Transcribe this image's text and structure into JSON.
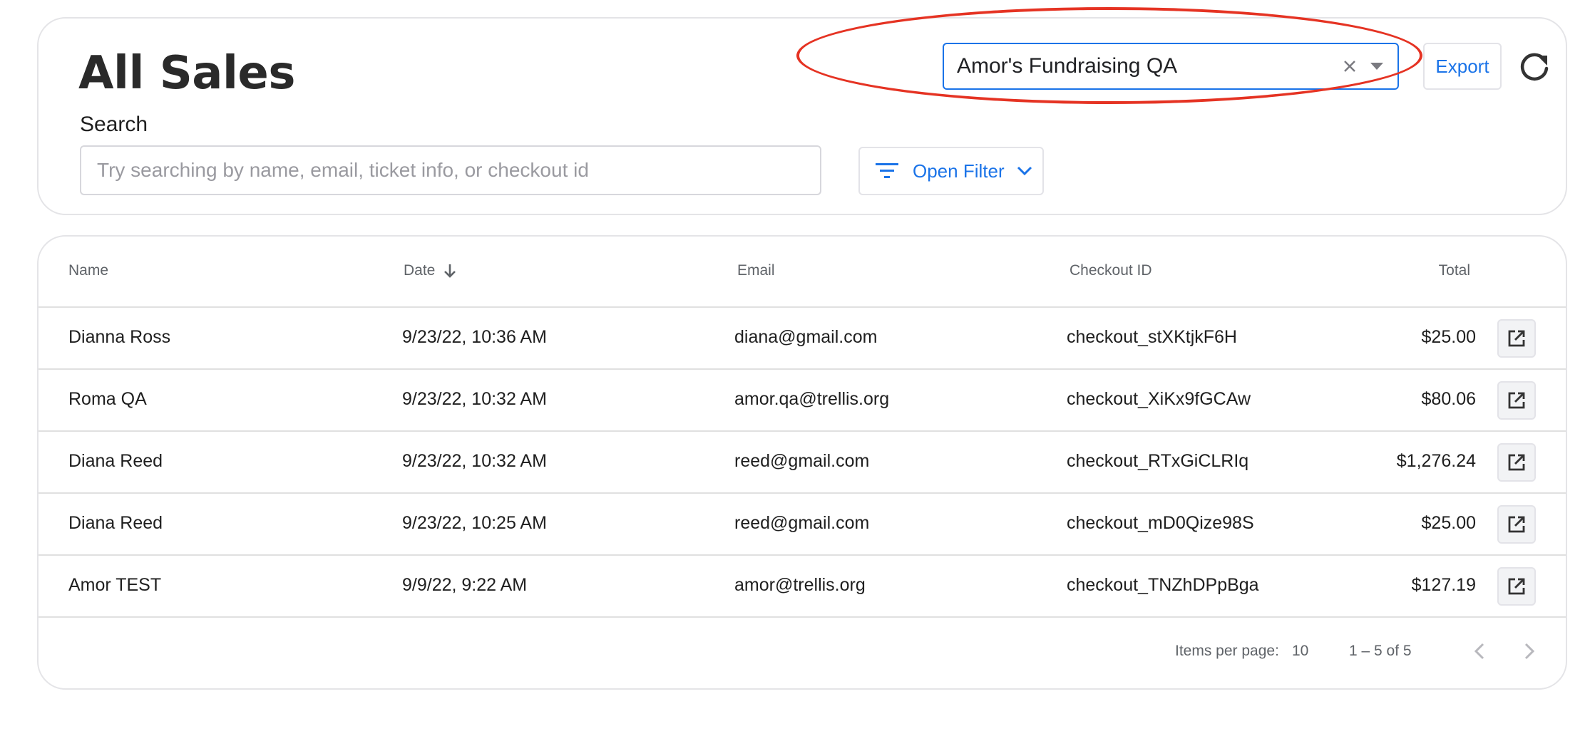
{
  "header": {
    "title": "All Sales",
    "search_label": "Search",
    "search_placeholder": "Try searching by name, email, ticket info, or checkout id",
    "search_value": "",
    "filter_label": "Open Filter",
    "org_select_value": "Amor's Fundraising QA",
    "export_label": "Export"
  },
  "table": {
    "columns": {
      "name": "Name",
      "date": "Date",
      "email": "Email",
      "checkout_id": "Checkout ID",
      "total": "Total"
    },
    "rows": [
      {
        "name": "Dianna Ross",
        "date": "9/23/22, 10:36 AM",
        "email": "diana@gmail.com",
        "checkout_id": "checkout_stXKtjkF6H",
        "total": "$25.00"
      },
      {
        "name": "Roma QA",
        "date": "9/23/22, 10:32 AM",
        "email": "amor.qa@trellis.org",
        "checkout_id": "checkout_XiKx9fGCAw",
        "total": "$80.06"
      },
      {
        "name": "Diana Reed",
        "date": "9/23/22, 10:32 AM",
        "email": "reed@gmail.com",
        "checkout_id": "checkout_RTxGiCLRIq",
        "total": "$1,276.24"
      },
      {
        "name": "Diana Reed",
        "date": "9/23/22, 10:25 AM",
        "email": "reed@gmail.com",
        "checkout_id": "checkout_mD0Qize98S",
        "total": "$25.00"
      },
      {
        "name": "Amor TEST",
        "date": "9/9/22, 9:22 AM",
        "email": "amor@trellis.org",
        "checkout_id": "checkout_TNZhDPpBga",
        "total": "$127.19"
      }
    ]
  },
  "paginator": {
    "items_per_page_label": "Items per page:",
    "items_per_page_value": "10",
    "range_label": "1 – 5 of 5"
  },
  "colors": {
    "accent": "#1a73e8",
    "highlight": "#e53323",
    "border": "#e0e0e0"
  },
  "icons": {
    "filter": "filter-lines-icon",
    "chevron": "chevron-down-icon",
    "clear": "close-icon",
    "caret": "caret-down-icon",
    "refresh": "refresh-icon",
    "sort": "arrow-down-icon",
    "open": "open-in-new-icon",
    "prev": "chevron-left-icon",
    "next": "chevron-right-icon"
  }
}
